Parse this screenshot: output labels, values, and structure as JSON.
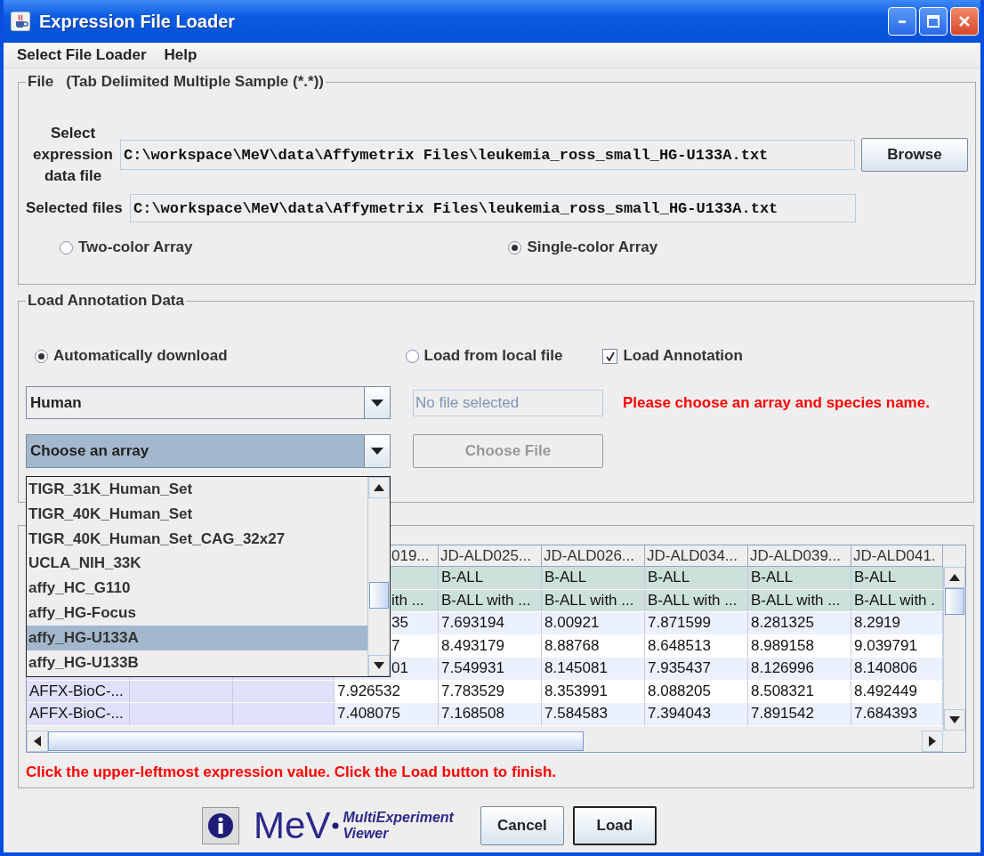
{
  "window": {
    "title": "Expression File Loader"
  },
  "menu": [
    "Select File Loader",
    "Help"
  ],
  "file_panel": {
    "title": "File",
    "subtitle": "(Tab Delimited Multiple Sample (*.*))",
    "select_label": "Select expression data file",
    "path_value": "C:\\workspace\\MeV\\data\\Affymetrix Files\\leukemia_ross_small_HG-U133A.txt",
    "browse_button": "Browse",
    "selected_label": "Selected files",
    "selected_value": "C:\\workspace\\MeV\\data\\Affymetrix Files\\leukemia_ross_small_HG-U133A.txt",
    "array_types": [
      {
        "label": "Two-color Array",
        "selected": false
      },
      {
        "label": "Single-color Array",
        "selected": true
      }
    ]
  },
  "annotation_panel": {
    "title": "Load Annotation Data",
    "sources": [
      {
        "label": "Automatically download",
        "selected": true
      },
      {
        "label": "Load from local file",
        "selected": false
      }
    ],
    "load_annotation": {
      "label": "Load Annotation",
      "checked": true
    },
    "species": "Human",
    "file_field": {
      "placeholder": "No file selected"
    },
    "warning": "Please choose an array and species name.",
    "array_combo": "Choose an array",
    "choose_file_button": {
      "label": "Choose File",
      "disabled": true
    },
    "array_list": [
      {
        "label": "TIGR_31K_Human_Set",
        "selected": false
      },
      {
        "label": "TIGR_40K_Human_Set",
        "selected": false
      },
      {
        "label": "TIGR_40K_Human_Set_CAG_32x27",
        "selected": false
      },
      {
        "label": "UCLA_NIH_33K",
        "selected": false
      },
      {
        "label": "affy_HC_G110",
        "selected": false
      },
      {
        "label": "affy_HG-Focus",
        "selected": false
      },
      {
        "label": "affy_HG-U133A",
        "selected": true
      },
      {
        "label": "affy_HG-U133B",
        "selected": false
      }
    ]
  },
  "table": {
    "columns": [
      "019...",
      "JD-ALD025...",
      "JD-ALD026...",
      "JD-ALD034...",
      "JD-ALD039...",
      "JD-ALD041."
    ],
    "rows": [
      {
        "kind": "annotation",
        "values": [
          "B-ALL",
          "B-ALL",
          "B-ALL",
          "B-ALL",
          "B-ALL"
        ]
      },
      {
        "kind": "annotation",
        "values": [
          "ith ...",
          "B-ALL with ...",
          "B-ALL with ...",
          "B-ALL with ...",
          "B-ALL with ...",
          "B-ALL with ."
        ]
      },
      {
        "kind": "data",
        "values": [
          "35",
          "7.693194",
          "8.00921",
          "7.871599",
          "8.281325",
          "8.2919"
        ]
      },
      {
        "kind": "data",
        "values": [
          "7",
          "8.493179",
          "8.88768",
          "8.648513",
          "8.989158",
          "9.039791"
        ]
      },
      {
        "kind": "data",
        "values": [
          "01",
          "7.549931",
          "8.145081",
          "7.935437",
          "8.126996",
          "8.140806"
        ]
      },
      {
        "kind": "data",
        "label": "AFFX-BioC-...",
        "values": [
          "7.926532",
          "7.783529",
          "8.353991",
          "8.088205",
          "8.508321",
          "8.492449"
        ]
      },
      {
        "kind": "data",
        "label": "AFFX-BioC-...",
        "values": [
          "7.408075",
          "7.168508",
          "7.584583",
          "7.394043",
          "7.891542",
          "7.684393"
        ]
      }
    ]
  },
  "instruction": "Click the upper-leftmost expression value. Click the Load button to finish.",
  "logo": {
    "name": "MeV",
    "tagline_1": "MultiExperiment",
    "tagline_2": "Viewer"
  },
  "buttons": [
    "Cancel",
    "Load"
  ]
}
